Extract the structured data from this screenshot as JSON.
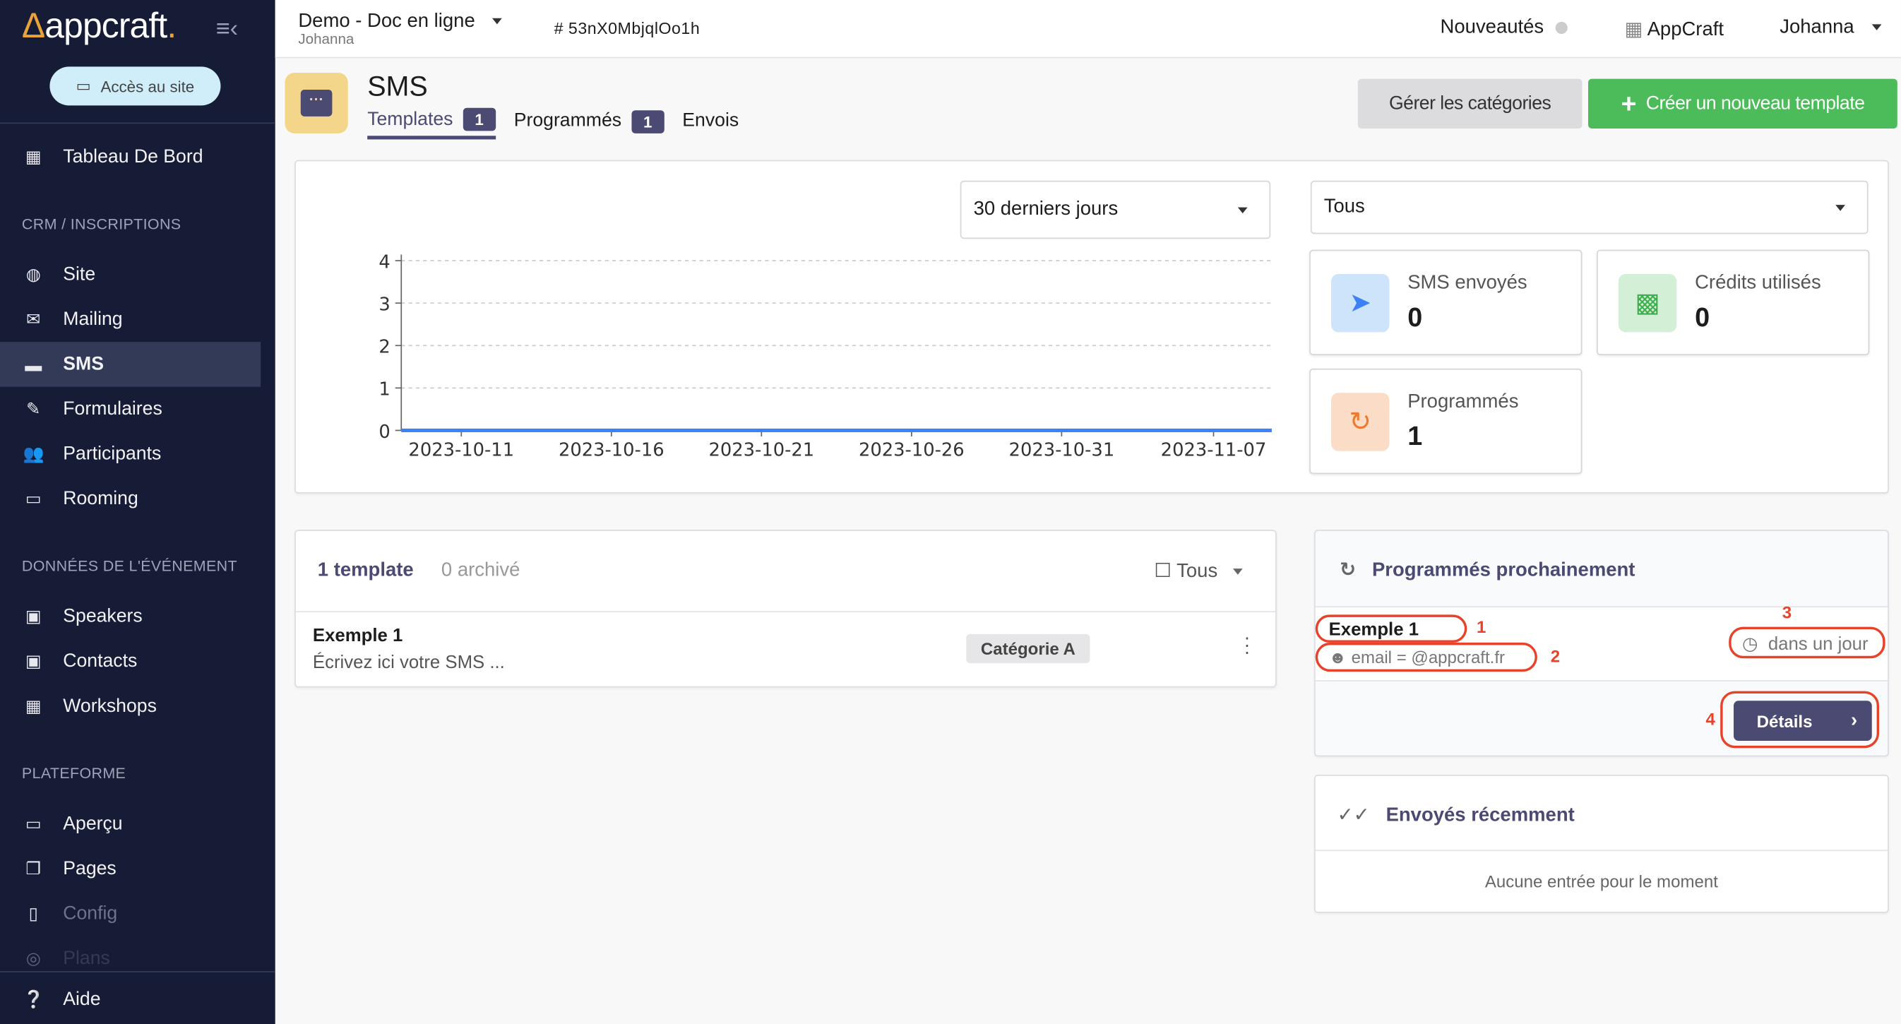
{
  "sidebar": {
    "logo": "appcraft",
    "site_button": "Accès au site",
    "items": [
      {
        "label": "Tableau De Bord",
        "icon": "dashboard-icon"
      },
      {
        "section": "CRM / INSCRIPTIONS"
      },
      {
        "label": "Site",
        "icon": "globe-icon"
      },
      {
        "label": "Mailing",
        "icon": "envelope-icon"
      },
      {
        "label": "SMS",
        "icon": "sms-icon",
        "active": true
      },
      {
        "label": "Formulaires",
        "icon": "pencil-icon"
      },
      {
        "label": "Participants",
        "icon": "users-icon"
      },
      {
        "label": "Rooming",
        "icon": "bed-icon"
      },
      {
        "section": "DONNÉES DE L'ÉVÉNEMENT"
      },
      {
        "label": "Speakers",
        "icon": "id-badge-icon"
      },
      {
        "label": "Contacts",
        "icon": "id-badge-icon"
      },
      {
        "label": "Workshops",
        "icon": "calendar-icon"
      },
      {
        "section": "PLATEFORME"
      },
      {
        "label": "Aperçu",
        "icon": "laptop-icon"
      },
      {
        "label": "Pages",
        "icon": "pages-icon"
      },
      {
        "label": "Config",
        "icon": "config-icon"
      },
      {
        "label": "Plans",
        "icon": "map-icon"
      }
    ],
    "help": "Aide"
  },
  "topbar": {
    "project": "Demo - Doc en ligne",
    "owner": "Johanna",
    "hash": "# 53nX0MbjqlOo1h",
    "news": "Nouveautés",
    "org": "AppCraft",
    "user": "Johanna"
  },
  "page": {
    "title": "SMS",
    "tabs": [
      {
        "label": "Templates",
        "count": "1"
      },
      {
        "label": "Programmés",
        "count": "1"
      },
      {
        "label": "Envois"
      }
    ],
    "manage_categories": "Gérer les catégories",
    "create_template": "Créer un nouveau template"
  },
  "filters": {
    "period": "30 derniers jours",
    "type": "Tous"
  },
  "stats": [
    {
      "label": "SMS envoyés",
      "value": "0"
    },
    {
      "label": "Crédits utilisés",
      "value": "0"
    },
    {
      "label": "Programmés",
      "value": "1"
    }
  ],
  "chart_data": {
    "type": "line",
    "x_start": "2023-10-09",
    "x_end": "2023-11-07",
    "x_ticks": [
      "2023-10-11",
      "2023-10-16",
      "2023-10-21",
      "2023-10-26",
      "2023-10-31",
      "2023-11-07"
    ],
    "y_ticks": [
      "0",
      "1",
      "2",
      "3",
      "4"
    ],
    "ylim": [
      0,
      4
    ],
    "grid": true,
    "series": [
      {
        "values_all": 0,
        "color": "#3b82f6"
      }
    ]
  },
  "templates": {
    "count": "1 template",
    "archived": "0 archivé",
    "filter": "Tous",
    "rows": [
      {
        "name": "Exemple 1",
        "preview": "Écrivez ici votre SMS ...",
        "category": "Catégorie A"
      }
    ]
  },
  "scheduled": {
    "title": "Programmés prochainement",
    "name": "Exemple 1",
    "target": "email = @appcraft.fr",
    "when": "dans un jour",
    "details": "Détails",
    "annotations": [
      "1",
      "2",
      "3",
      "4"
    ]
  },
  "recent": {
    "title": "Envoyés récemment",
    "empty": "Aucune entrée pour le moment"
  }
}
